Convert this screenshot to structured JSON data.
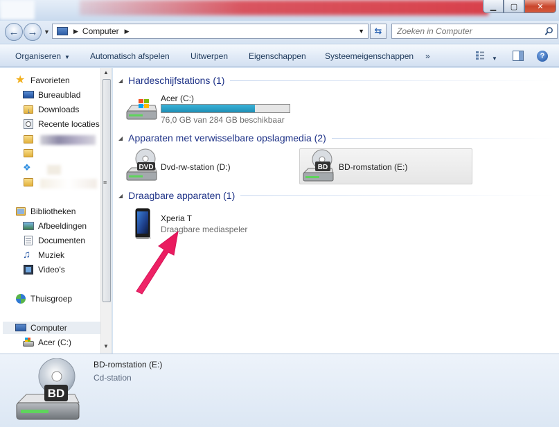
{
  "titlebar": {
    "controls": {
      "minimize": "▁",
      "maximize": "▢",
      "close": "✕"
    }
  },
  "address": {
    "path": "Computer",
    "search_placeholder": "Zoeken in Computer"
  },
  "commands": {
    "organize": "Organiseren",
    "autoplay": "Automatisch afspelen",
    "eject": "Uitwerpen",
    "properties": "Eigenschappen",
    "system_properties": "Systeemeigenschappen",
    "more": "»"
  },
  "nav": {
    "favorites": "Favorieten",
    "desktop": "Bureaublad",
    "downloads": "Downloads",
    "recent": "Recente locaties",
    "libraries": "Bibliotheken",
    "pictures": "Afbeeldingen",
    "documents": "Documenten",
    "music": "Muziek",
    "videos": "Video's",
    "homegroup": "Thuisgroep",
    "computer": "Computer",
    "drive_c": "Acer (C:)"
  },
  "groups": {
    "hdd": "Hardeschijfstations (1)",
    "removable": "Apparaten met verwisselbare opslagmedia (2)",
    "portable": "Draagbare apparaten (1)"
  },
  "drives": {
    "c": {
      "name": "Acer (C:)",
      "free": "76,0 GB van 284 GB beschikbaar",
      "used_fraction": 0.73
    },
    "d": {
      "name": "Dvd-rw-station (D:)",
      "badge": "DVD"
    },
    "e": {
      "name": "BD-romstation (E:)",
      "badge": "BD"
    },
    "phone": {
      "name": "Xperia T",
      "type": "Draagbare mediaspeler"
    }
  },
  "details": {
    "name": "BD-romstation (E:)",
    "type": "Cd-station",
    "badge": "BD"
  },
  "colors": {
    "group_title": "#1e3287",
    "progress": "#26a0c9",
    "annotation_arrow": "#f0286a"
  }
}
